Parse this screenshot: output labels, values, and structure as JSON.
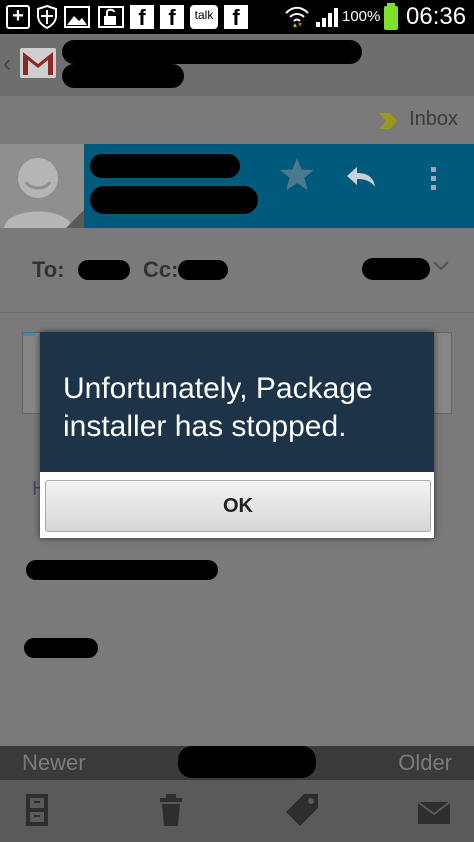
{
  "status_bar": {
    "battery": "100%",
    "time": "06:36",
    "talk_badge": "talk",
    "facebook_glyph": "f"
  },
  "header": {
    "label": "Inbox"
  },
  "recipients": {
    "to_label": "To:",
    "cc_label": "Cc:"
  },
  "body": {
    "link_initial": "H"
  },
  "dialog": {
    "message": "Unfortunately, Package installer has stopped.",
    "ok_label": "OK"
  },
  "pager": {
    "newer_label": "Newer",
    "older_label": "Older"
  },
  "colors": {
    "dialog_body": "#1d3347",
    "sender_band": "#005a7c",
    "battery": "#7ee02a"
  }
}
